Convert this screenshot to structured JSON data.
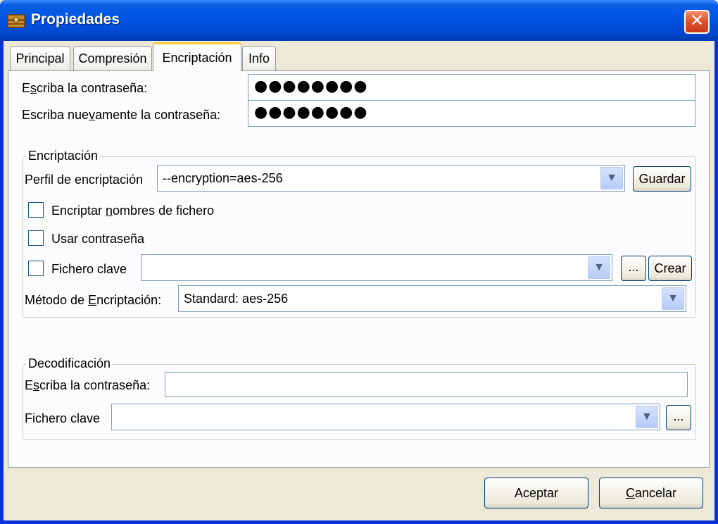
{
  "window": {
    "title": "Propiedades",
    "close_glyph": "✕"
  },
  "tabs": [
    {
      "label": "Principal",
      "active": false
    },
    {
      "label": "Compresión",
      "active": false
    },
    {
      "label": "Encriptación",
      "active": true
    },
    {
      "label": "Info",
      "active": false
    }
  ],
  "password": {
    "label_pre": "E",
    "label_ul": "s",
    "label_post": "criba la contraseña:",
    "value": "●●●●●●●●",
    "confirm_label_pre": "Escriba nue",
    "confirm_label_ul": "v",
    "confirm_label_post": "amente la contraseña:",
    "confirm_value": "●●●●●●●●"
  },
  "encryption": {
    "legend": "Encriptación",
    "profile_label": "Perfil de encriptación",
    "profile_value": "--encryption=aes-256",
    "save_button": "Guardar",
    "encrypt_names_pre": "Encriptar ",
    "encrypt_names_ul": "n",
    "encrypt_names_post": "ombres de fichero",
    "encrypt_names_checked": false,
    "use_password_label": "Usar contraseña",
    "use_password_checked": false,
    "keyfile_label": "Fichero clave",
    "keyfile_checked": false,
    "keyfile_value": "",
    "browse_button": "...",
    "create_button": "Crear",
    "method_label_pre": "Método de ",
    "method_label_ul": "E",
    "method_label_post": "ncriptación:",
    "method_value": "Standard: aes-256"
  },
  "decoding": {
    "legend": "Decodificación",
    "password_label_pre": "E",
    "password_label_ul": "s",
    "password_label_post": "criba la contraseña:",
    "password_value": "",
    "keyfile_label": "Fichero clave",
    "keyfile_value": "",
    "browse_button": "..."
  },
  "footer": {
    "ok_button": "Aceptar",
    "cancel_ul": "C",
    "cancel_post": "ancelar"
  },
  "icons": {
    "app": "archive-icon",
    "dropdown": "chevron-down-icon"
  }
}
